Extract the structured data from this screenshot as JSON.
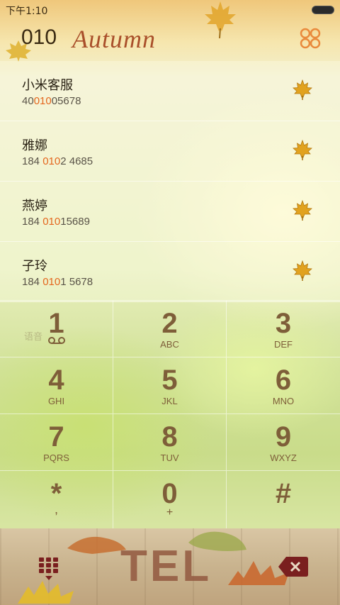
{
  "status_bar": {
    "time": "下午1:10"
  },
  "header": {
    "digits": "010",
    "brand": "Autumn"
  },
  "contacts": [
    {
      "name": "小米客服",
      "number_pre": "40",
      "number_hl": "010",
      "number_post": "05678"
    },
    {
      "name": "雅娜",
      "number_pre": "184 ",
      "number_hl": "010",
      "number_post": "2 4685"
    },
    {
      "name": "燕婷",
      "number_pre": "184 ",
      "number_hl": "010",
      "number_post": "15689"
    },
    {
      "name": "子玲",
      "number_pre": "184 ",
      "number_hl": "010",
      "number_post": "1 5678"
    }
  ],
  "keypad": {
    "voicemail_label": "语音",
    "keys": [
      {
        "digit": "1",
        "letters": ""
      },
      {
        "digit": "2",
        "letters": "ABC"
      },
      {
        "digit": "3",
        "letters": "DEF"
      },
      {
        "digit": "4",
        "letters": "GHI"
      },
      {
        "digit": "5",
        "letters": "JKL"
      },
      {
        "digit": "6",
        "letters": "MNO"
      },
      {
        "digit": "7",
        "letters": "PQRS"
      },
      {
        "digit": "8",
        "letters": "TUV"
      },
      {
        "digit": "9",
        "letters": "WXYZ"
      },
      {
        "digit": "*",
        "letters": ","
      },
      {
        "digit": "0",
        "letters": "+"
      },
      {
        "digit": "#",
        "letters": ""
      }
    ]
  },
  "bottom_bar": {
    "call_label": "TEL"
  },
  "colors": {
    "highlight": "#e4671e",
    "key_text": "#7e5e39",
    "brand": "#a94f2a",
    "leaf": "#e1a21f"
  },
  "icons": {
    "contact_action": "maple-leaf-icon",
    "menu": "clover-menu-icon",
    "dialpad": "dialpad-grid-icon",
    "delete": "backspace-icon",
    "voicemail": "voicemail-icon"
  }
}
